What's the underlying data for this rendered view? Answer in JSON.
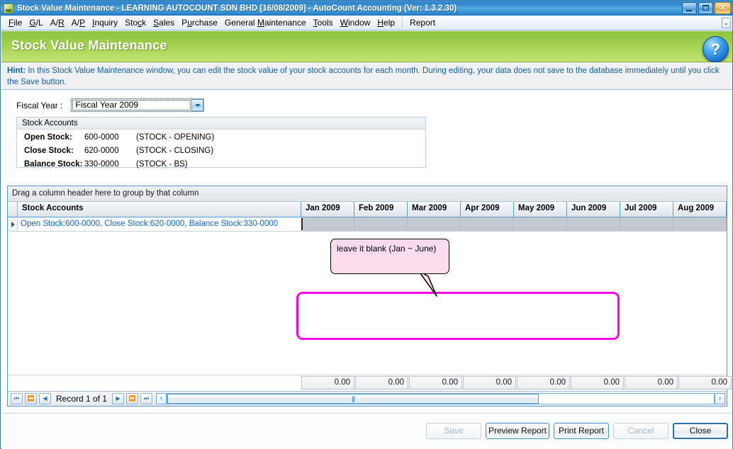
{
  "window": {
    "title": "Stock Value Maintenance - LEARNING AUTOCOUNT SDN BHD [16/08/2009] - AutoCount Accounting (Ver: 1.3.2.30)",
    "icon": "app-icon",
    "minimize_label": "",
    "maximize_label": "",
    "close_label": "✕"
  },
  "menubar": {
    "items": [
      {
        "label": "File",
        "mnemonic": "F"
      },
      {
        "label": "G/L",
        "mnemonic": "G"
      },
      {
        "label": "A/R",
        "mnemonic": "R"
      },
      {
        "label": "A/P",
        "mnemonic": "P"
      },
      {
        "label": "Inquiry",
        "mnemonic": "I"
      },
      {
        "label": "Stock",
        "mnemonic": "c"
      },
      {
        "label": "Sales",
        "mnemonic": "S"
      },
      {
        "label": "Purchase",
        "mnemonic": "u"
      },
      {
        "label": "General Maintenance",
        "mnemonic": "M"
      },
      {
        "label": "Tools",
        "mnemonic": "T"
      },
      {
        "label": "Window",
        "mnemonic": "W"
      },
      {
        "label": "Help",
        "mnemonic": "H"
      },
      {
        "label": "Report",
        "mnemonic": ""
      }
    ],
    "overflow_label": "⌄"
  },
  "caption": {
    "title": "Stock Value Maintenance",
    "help_label": "?",
    "band_color": "#9ccc49"
  },
  "hint": {
    "label": "Hint:",
    "text": " In this Stock Value Maintenance window, you can edit the stock value of your stock accounts for each month. During editing, your data does not save to the database immediately until you click the Save button."
  },
  "fiscal_year": {
    "label": "Fiscal Year :",
    "value": "Fiscal Year 2009",
    "placeholder": "Fiscal Year 2009"
  },
  "stock_accounts": {
    "group_title": "Stock Accounts",
    "rows": [
      {
        "name": "Open Stock:",
        "code": "600-0000",
        "desc": "(STOCK - OPENING)"
      },
      {
        "name": "Close Stock:",
        "code": "620-0000",
        "desc": "(STOCK - CLOSING)"
      },
      {
        "name": "Balance Stock:",
        "code": "330-0000",
        "desc": "(STOCK - BS)"
      }
    ]
  },
  "callout": {
    "text": "leave it blank (Jan ~ June)",
    "fill_color": "#fbdcec",
    "border_color": "#000000"
  },
  "annotation": {
    "rect_color": "#ff00e4"
  },
  "grid": {
    "group_panel_text": "Drag a column header here to group by that column",
    "columns": [
      "Stock Accounts",
      "Jan 2009",
      "Feb 2009",
      "Mar 2009",
      "Apr 2009",
      "May 2009",
      "Jun 2009",
      "Jul 2009",
      "Aug 2009"
    ],
    "rows": [
      {
        "account": "Open Stock:600-0000, Close Stock:620-0000, Balance Stock:330-0000",
        "values": [
          "",
          "",
          "",
          "",
          "",
          "",
          "",
          ""
        ]
      }
    ],
    "footer_totals": [
      "0.00",
      "0.00",
      "0.00",
      "0.00",
      "0.00",
      "0.00",
      "0.00",
      "0.00"
    ]
  },
  "navigator": {
    "first_label": "⏮",
    "prev_page_label": "⏪",
    "prev_label": "◀",
    "record_label": "Record 1 of 1",
    "next_label": "▶",
    "next_page_label": "⏩",
    "last_label": "⏭",
    "scroll_left_label": "‹",
    "scroll_right_label": "›"
  },
  "buttons": {
    "save": {
      "label": "Save",
      "enabled": false
    },
    "preview_report": {
      "label": "Preview Report",
      "enabled": true
    },
    "print_report": {
      "label": "Print Report",
      "enabled": true
    },
    "cancel": {
      "label": "Cancel",
      "enabled": false
    },
    "close": {
      "label": "Close",
      "enabled": true
    }
  }
}
